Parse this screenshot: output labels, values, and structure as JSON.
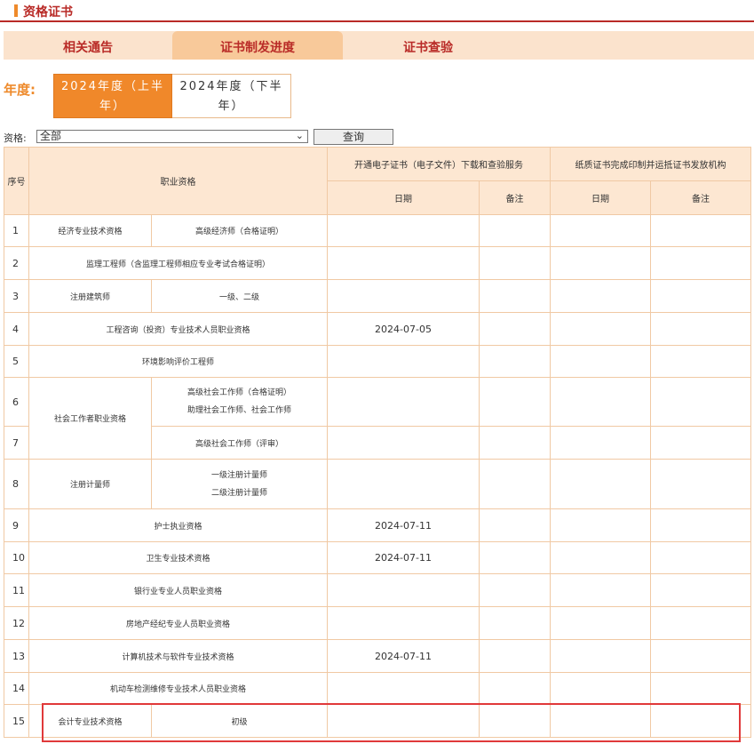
{
  "header": {
    "title": "资格证书"
  },
  "tabs": [
    {
      "label": "相关通告"
    },
    {
      "label": "证书制发进度"
    },
    {
      "label": "证书查验"
    }
  ],
  "year_filter": {
    "label": "年度:",
    "options": [
      "2024年度（上半年）",
      "2024年度（下半年）"
    ],
    "selected": "2024年度（上半年）"
  },
  "qual_filter": {
    "label": "资格:",
    "selected": "全部",
    "query_label": "查询"
  },
  "table": {
    "headers": {
      "seq": "序号",
      "qualification": "职业资格",
      "electronic": "开通电子证书（电子文件）下载和查验服务",
      "paper": "纸质证书完成印制并运抵证书发放机构",
      "date": "日期",
      "note": "备注"
    },
    "rows": [
      {
        "num": "1",
        "category": "经济专业技术资格",
        "level": "高级经济师（合格证明）",
        "date": ""
      },
      {
        "num": "2",
        "category": "监理工程师（含监理工程师相应专业考试合格证明）",
        "level": "",
        "date": ""
      },
      {
        "num": "3",
        "category": "注册建筑师",
        "level": "一级、二级",
        "date": ""
      },
      {
        "num": "4",
        "category": "工程咨询（投资）专业技术人员职业资格",
        "level": "",
        "date": "2024-07-05"
      },
      {
        "num": "5",
        "category": "环境影响评价工程师",
        "level": "",
        "date": ""
      },
      {
        "num": "6",
        "category": "社会工作者职业资格",
        "level": "高级社会工作师（合格证明）",
        "level2": "助理社会工作师、社会工作师",
        "date": ""
      },
      {
        "num": "7",
        "category": "",
        "level": "高级社会工作师（评审）",
        "date": ""
      },
      {
        "num": "8",
        "category": "注册计量师",
        "level": "一级注册计量师",
        "level2": "二级注册计量师",
        "date": ""
      },
      {
        "num": "9",
        "category": "护士执业资格",
        "level": "",
        "date": "2024-07-11"
      },
      {
        "num": "10",
        "category": "卫生专业技术资格",
        "level": "",
        "date": "2024-07-11"
      },
      {
        "num": "11",
        "category": "银行业专业人员职业资格",
        "level": "",
        "date": ""
      },
      {
        "num": "12",
        "category": "房地产经纪专业人员职业资格",
        "level": "",
        "date": ""
      },
      {
        "num": "13",
        "category": "计算机技术与软件专业技术资格",
        "level": "",
        "date": "2024-07-11"
      },
      {
        "num": "14",
        "category": "机动车检测维修专业技术人员职业资格",
        "level": "",
        "date": ""
      },
      {
        "num": "15",
        "category": "会计专业技术资格",
        "level": "初级",
        "date": ""
      }
    ]
  },
  "colors": {
    "accent": "#b92b27",
    "orange": "#f0882a",
    "tab_bg": "#fbe3cd",
    "header_bg": "#fde7d2",
    "highlight": "#e0393a"
  }
}
